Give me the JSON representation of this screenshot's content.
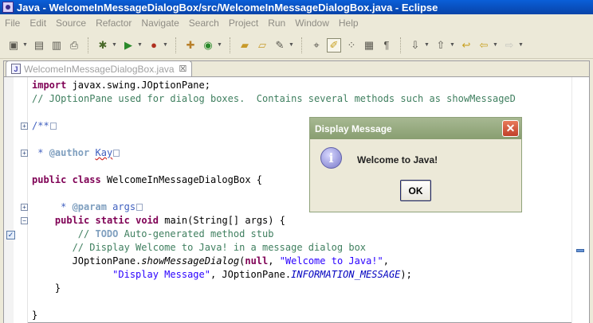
{
  "window": {
    "title": "Java - WelcomeInMessageDialogBox/src/WelcomeInMessageDialogBox.java - Eclipse"
  },
  "menu": [
    "File",
    "Edit",
    "Source",
    "Refactor",
    "Navigate",
    "Search",
    "Project",
    "Run",
    "Window",
    "Help"
  ],
  "toolbar": {
    "icons": [
      "new-icon",
      "save-icon",
      "save-all-icon",
      "print-icon",
      "debug-icon",
      "run-icon",
      "run-external-icon",
      "new-java-project-icon",
      "new-class-icon",
      "open-type-icon",
      "open-resource-icon",
      "search-icon",
      "toggle-mark-occurrences-icon",
      "toggle-highlight-icon",
      "show-whitespace-icon",
      "block-selection-icon",
      "show-source-icon",
      "next-annotation-icon",
      "previous-annotation-icon",
      "last-edit-icon",
      "back-icon",
      "forward-icon"
    ]
  },
  "editor": {
    "tab_label": "WelcomeInMessageDialogBox.java",
    "tab_icon_glyph": "J",
    "tab_close_glyph": "☒",
    "code": {
      "l1_kw": "import",
      "l1_rest": " javax.swing.JOptionPane;",
      "l2": "// JOptionPane used for dialog boxes.  Contains several methods such as showMessageD",
      "l3": "/**",
      "l4_pre": " * ",
      "l4_tag": "@author",
      "l4_name": "Kay",
      "l5_kw1": "public",
      "l5_kw2": "class",
      "l5_rest": " WelcomeInMessageDialogBox {",
      "l6_pre": "     * ",
      "l6_tag": "@param",
      "l6_arg": " args",
      "l7_pre": "    ",
      "l7_kw1": "public",
      "l7_kw2": "static",
      "l7_kw3": "void",
      "l7_rest": " main(String[] args) {",
      "l8_pre": "        // ",
      "l8_todo": "TODO",
      "l8_rest": " Auto-generated method stub",
      "l9": "       // Display Welcome to Java! in a message dialog box",
      "l10_pre": "       JOptionPane.",
      "l10_method": "showMessageDialog",
      "l10_open": "(",
      "l10_null": "null",
      "l10_comma": ", ",
      "l10_str": "\"Welcome to Java!\"",
      "l10_end": ",",
      "l11_pre": "              ",
      "l11_str": "\"Display Message\"",
      "l11_mid": ", JOptionPane.",
      "l11_const": "INFORMATION_MESSAGE",
      "l11_end": ");",
      "l12": "    }",
      "l13": "}"
    },
    "fold_plus": "+",
    "fold_minus": "−",
    "task_glyph": "✓"
  },
  "dialog": {
    "title": "Display Message",
    "close_glyph": "✕",
    "icon_glyph": "i",
    "message": "Welcome to Java!",
    "ok_label": "OK"
  }
}
